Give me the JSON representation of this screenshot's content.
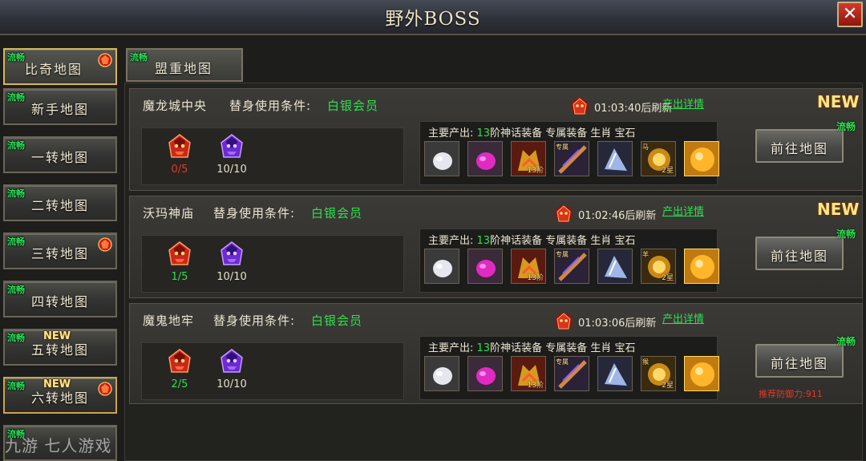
{
  "window": {
    "title": "野外BOSS",
    "close_symbol": "✕"
  },
  "tags": {
    "fluency": "流畅",
    "new": "NEW"
  },
  "sidebar": {
    "items": [
      {
        "label": "比奇地图",
        "active": true,
        "boss": true,
        "new": false
      },
      {
        "label": "新手地图",
        "active": false,
        "boss": false,
        "new": false
      },
      {
        "label": "一转地图",
        "active": false,
        "boss": false,
        "new": false
      },
      {
        "label": "二转地图",
        "active": false,
        "boss": false,
        "new": false
      },
      {
        "label": "三转地图",
        "active": false,
        "boss": true,
        "new": false
      },
      {
        "label": "四转地图",
        "active": false,
        "boss": false,
        "new": false
      },
      {
        "label": "五转地图",
        "active": false,
        "boss": false,
        "new": true
      },
      {
        "label": "六转地图",
        "active": false,
        "boss": true,
        "new": true
      }
    ]
  },
  "tabs": [
    {
      "label": "盟重地图"
    }
  ],
  "cards": [
    {
      "name": "魔龙城中央",
      "condition_label": "替身使用条件:",
      "condition_value": "白银会员",
      "timer": "01:03:40后刷新",
      "detail_link": "产出详情",
      "red_boss_count": "0/5",
      "purple_boss_count": "10/10",
      "loot_prefix": "主要产出:",
      "loot_level": "13",
      "loot_rest": "阶神话装备 专属装备 生肖 宝石",
      "go_button": "前往地图",
      "is_new": true,
      "item_labels": [
        "",
        "",
        "13阶",
        "专属",
        "",
        "马",
        "2星",
        ""
      ]
    },
    {
      "name": "沃玛神庙",
      "condition_label": "替身使用条件:",
      "condition_value": "白银会员",
      "timer": "01:02:46后刷新",
      "detail_link": "产出详情",
      "red_boss_count": "1/5",
      "purple_boss_count": "10/10",
      "loot_prefix": "主要产出:",
      "loot_level": "13",
      "loot_rest": "阶神话装备 专属装备 生肖 宝石",
      "go_button": "前往地图",
      "is_new": true,
      "item_labels": [
        "",
        "",
        "13阶",
        "专属",
        "",
        "羊",
        "2星",
        ""
      ]
    },
    {
      "name": "魔鬼地牢",
      "condition_label": "替身使用条件:",
      "condition_value": "白银会员",
      "timer": "01:03:06后刷新",
      "detail_link": "产出详情",
      "red_boss_count": "2/5",
      "purple_boss_count": "10/10",
      "loot_prefix": "主要产出:",
      "loot_level": "13",
      "loot_rest": "阶神话装备 专属装备 生肖 宝石",
      "go_button": "前往地图",
      "is_new": false,
      "item_labels": [
        "",
        "",
        "13阶",
        "专属",
        "",
        "猴",
        "2星",
        ""
      ],
      "defense_hint": "推荐防御力:911"
    }
  ],
  "colors": {
    "green": "#2ee04f",
    "red_count": "#e03a2a",
    "accent_gold": "#d6b65a"
  },
  "watermark": "九游 七人游戏"
}
